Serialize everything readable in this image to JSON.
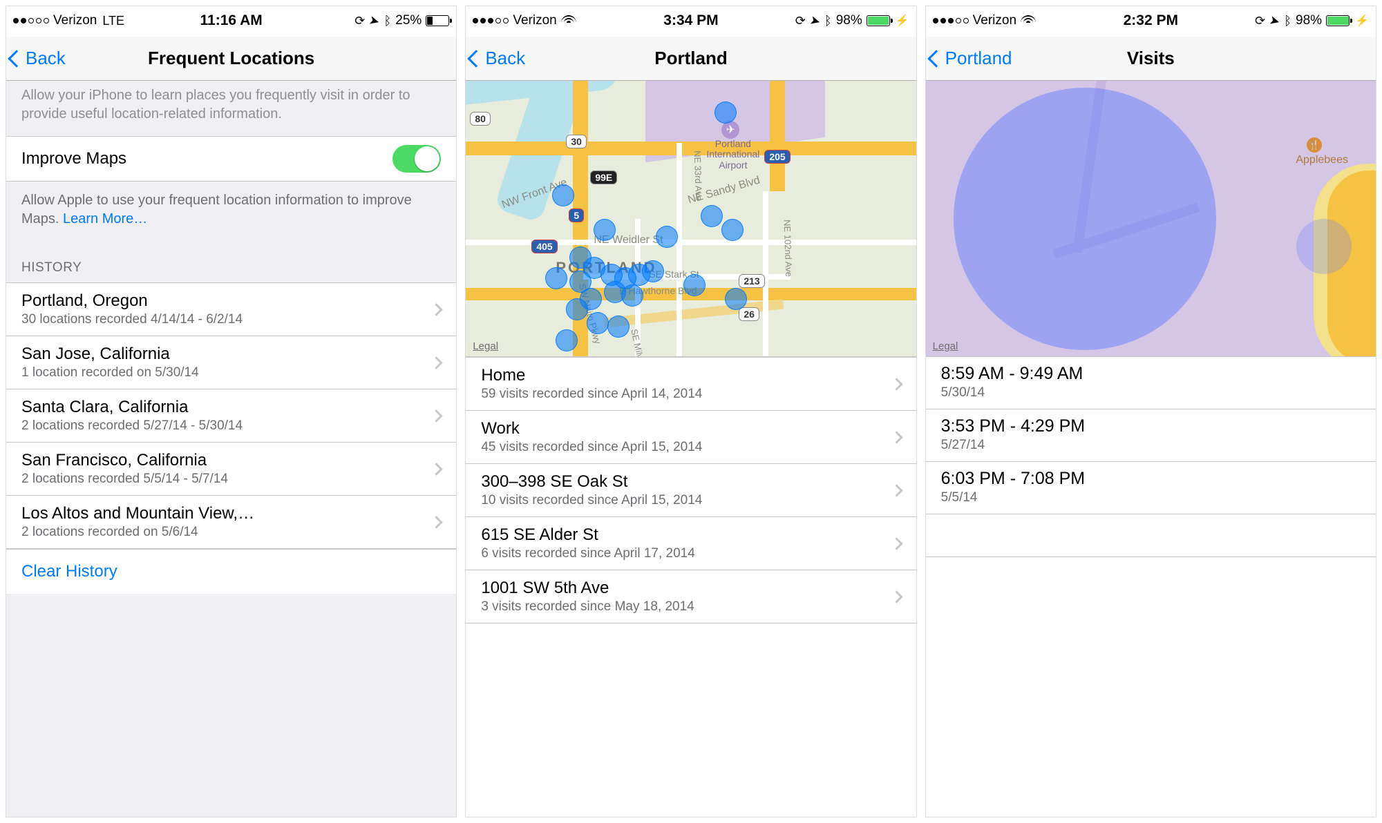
{
  "screens": {
    "s1": {
      "status": {
        "carrier": "Verizon",
        "conn": "LTE",
        "time": "11:16 AM",
        "batt_pct": "25%",
        "batt_level": 0.25,
        "batt_green": false,
        "charging": false,
        "signal_filled": 2
      },
      "nav": {
        "back": "Back",
        "title": "Frequent Locations"
      },
      "desc_top": "Allow your iPhone to learn places you frequently visit in order to provide useful location-related information.",
      "improve_maps_label": "Improve Maps",
      "desc_mid_a": "Allow Apple to use your frequent location information to improve Maps. ",
      "learn_more": "Learn More…",
      "history_header": "HISTORY",
      "history": [
        {
          "title": "Portland, Oregon",
          "sub": "30 locations recorded 4/14/14 - 6/2/14"
        },
        {
          "title": "San Jose, California",
          "sub": "1 location recorded on 5/30/14"
        },
        {
          "title": "Santa Clara, California",
          "sub": "2 locations recorded 5/27/14 - 5/30/14"
        },
        {
          "title": "San Francisco, California",
          "sub": "2 locations recorded 5/5/14 - 5/7/14"
        },
        {
          "title": "Los Altos and Mountain View,…",
          "sub": "2 locations recorded on 5/6/14"
        }
      ],
      "clear": "Clear History"
    },
    "s2": {
      "status": {
        "carrier": "Verizon",
        "conn": "wifi",
        "time": "3:34 PM",
        "batt_pct": "98%",
        "batt_level": 0.98,
        "batt_green": true,
        "charging": true,
        "signal_filled": 3
      },
      "nav": {
        "back": "Back",
        "title": "Portland"
      },
      "map": {
        "legal": "Legal",
        "airport": "Portland\nInternational\nAirport",
        "city": "PORTLAND",
        "streets": [
          "NW Front Ave",
          "NE Weidler St",
          "NE Sandy Blvd",
          "E Hawthorne Blvd",
          "SE Stark St",
          "SW Naito Pkwy",
          "SE Milw",
          "NE 33rd Ave",
          "NE 102nd Ave"
        ],
        "shields": [
          "80",
          "30",
          "99E",
          "5",
          "405",
          "205",
          "213",
          "26"
        ]
      },
      "places": [
        {
          "title": "Home",
          "sub": "59 visits recorded since April 14, 2014"
        },
        {
          "title": "Work",
          "sub": "45 visits recorded since April 15, 2014"
        },
        {
          "title": "300–398 SE Oak St",
          "sub": "10 visits recorded since April 15, 2014"
        },
        {
          "title": "615 SE Alder St",
          "sub": "6 visits recorded since April 17, 2014"
        },
        {
          "title": "1001 SW 5th Ave",
          "sub": "3 visits recorded since May 18, 2014"
        }
      ]
    },
    "s3": {
      "status": {
        "carrier": "Verizon",
        "conn": "wifi",
        "time": "2:32 PM",
        "batt_pct": "98%",
        "batt_level": 0.98,
        "batt_green": true,
        "charging": true,
        "signal_filled": 3
      },
      "nav": {
        "back": "Portland",
        "title": "Visits"
      },
      "map": {
        "legal": "Legal",
        "poi": "Applebees"
      },
      "visits": [
        {
          "t": "8:59 AM - 9:49 AM",
          "d": "5/30/14"
        },
        {
          "t": "3:53 PM - 4:29 PM",
          "d": "5/27/14"
        },
        {
          "t": "6:03 PM - 7:08 PM",
          "d": "5/5/14"
        }
      ]
    }
  }
}
